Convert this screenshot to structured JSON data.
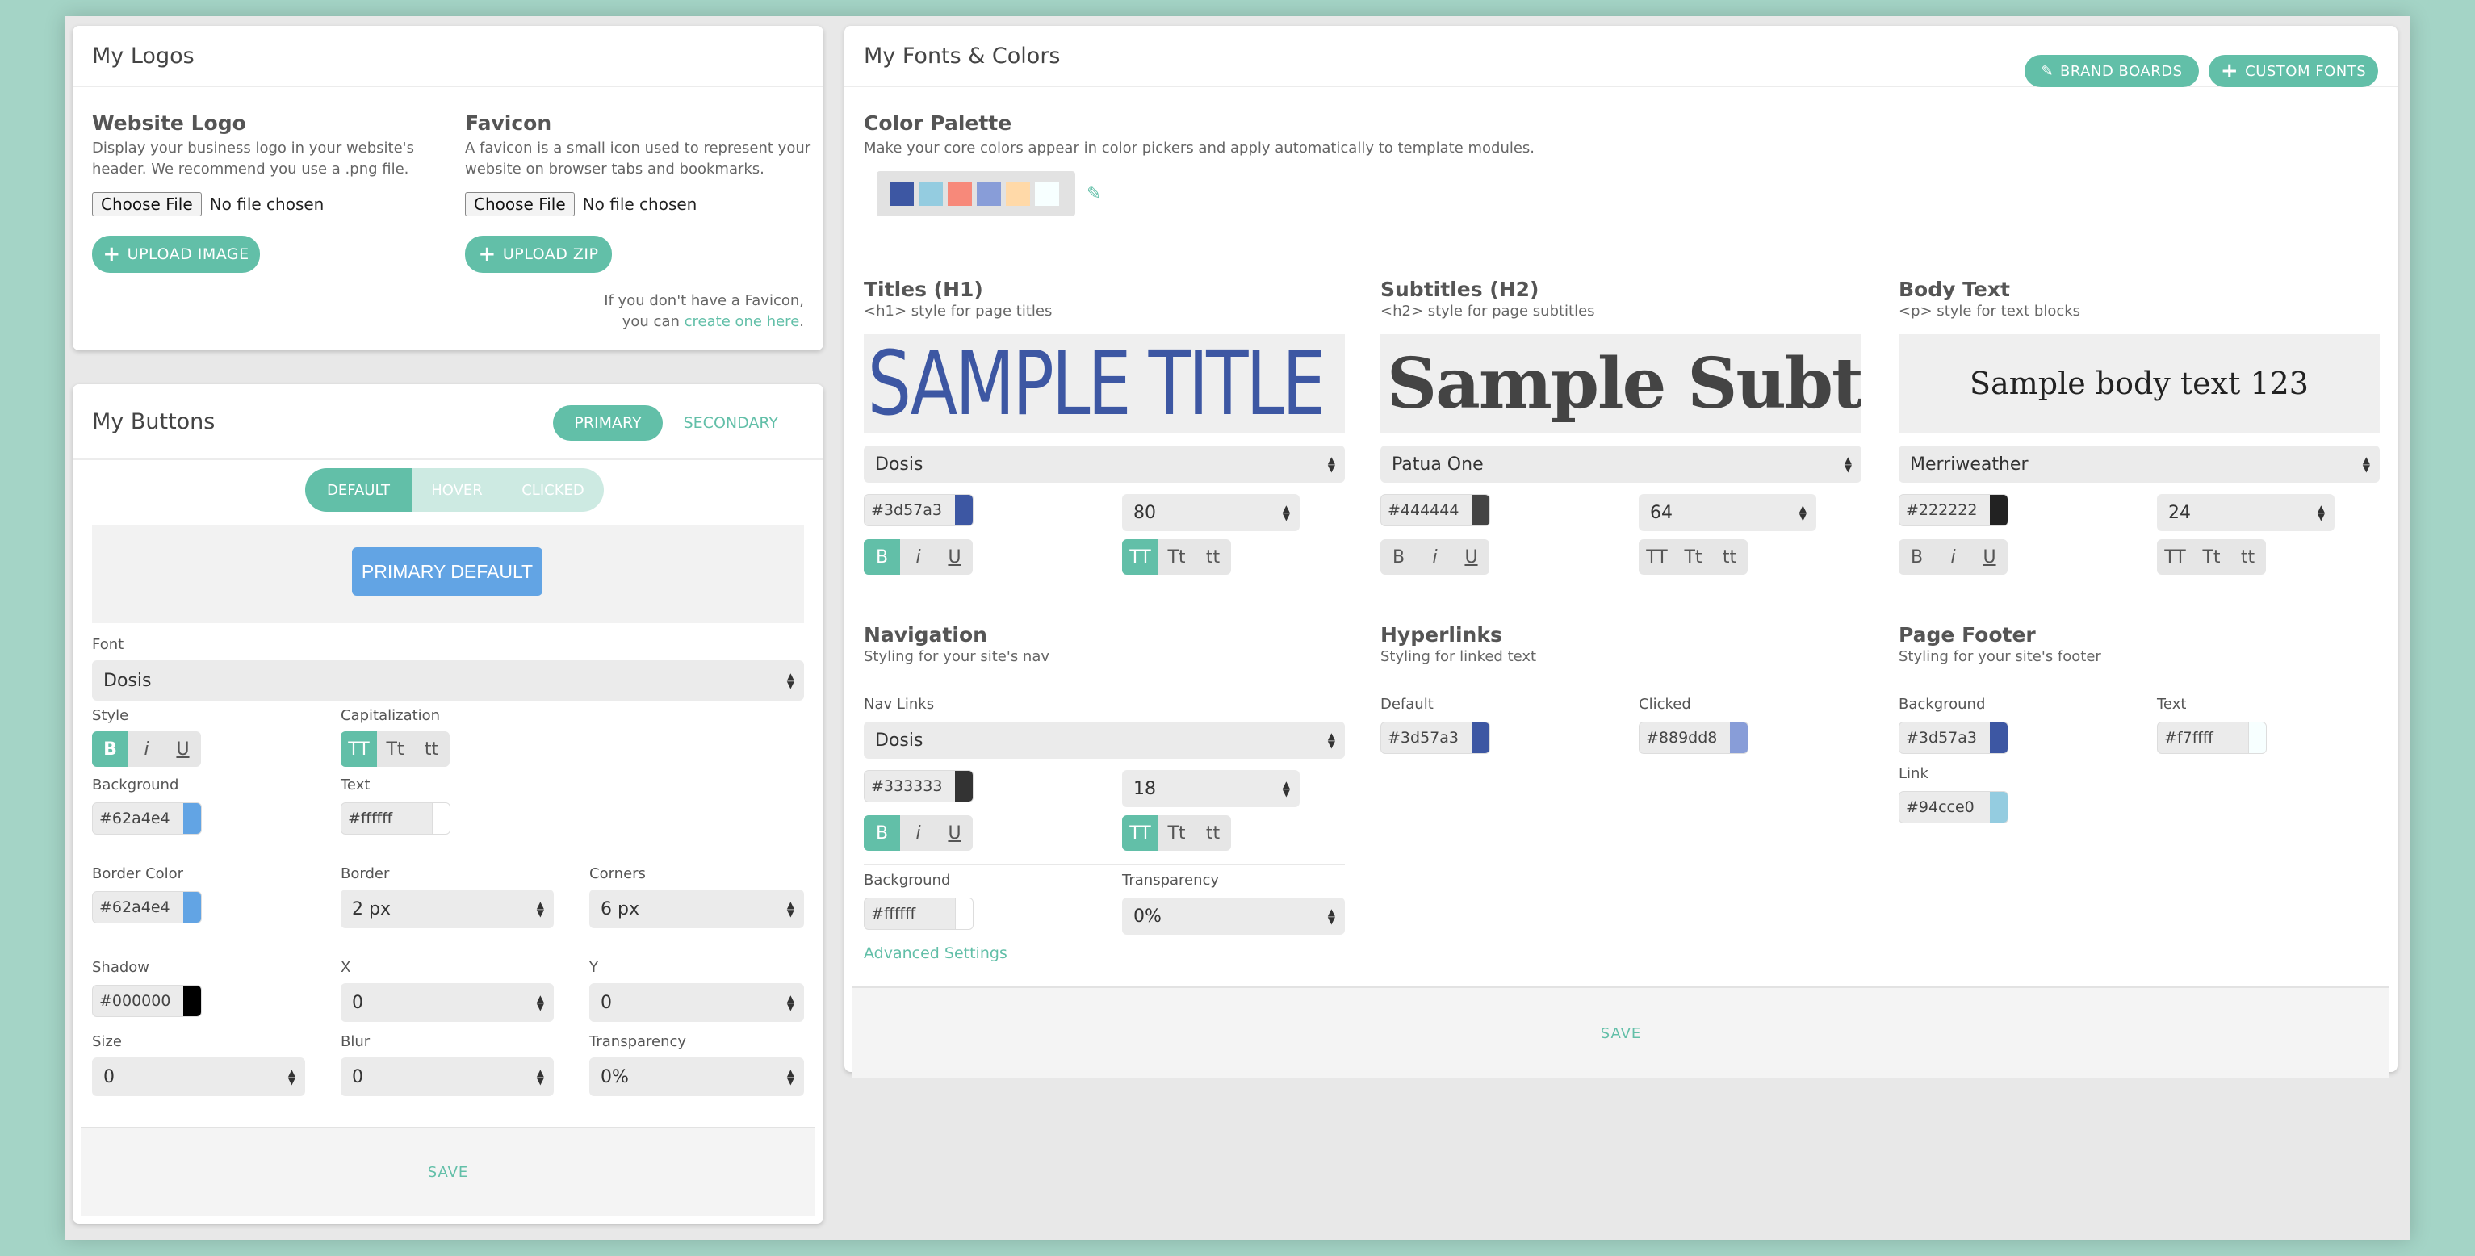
{
  "logos": {
    "title": "My Logos",
    "website_logo": {
      "heading": "Website Logo",
      "desc_line1": "Display your business logo in your website's",
      "desc_line2": "header. We recommend you use a .png file.",
      "choose_file": "Choose File",
      "no_file": "No file chosen",
      "upload": "UPLOAD IMAGE"
    },
    "favicon": {
      "heading": "Favicon",
      "desc_line1": "A favicon is a small icon used to represent your",
      "desc_line2": "website on browser tabs and bookmarks.",
      "choose_file": "Choose File",
      "no_file": "No file chosen",
      "upload": "UPLOAD ZIP",
      "note_line1": "If you don't have a Favicon,",
      "note_line2_prefix": "you can ",
      "note_link": "create one here",
      "note_suffix": "."
    }
  },
  "buttons": {
    "title": "My Buttons",
    "tabs": [
      "PRIMARY",
      "SECONDARY"
    ],
    "states": [
      "DEFAULT",
      "HOVER",
      "CLICKED"
    ],
    "preview_label": "PRIMARY DEFAULT",
    "font_label": "Font",
    "font_value": "Dosis",
    "style_label": "Style",
    "cap_label": "Capitalization",
    "style_buttons": [
      "B",
      "i",
      "U"
    ],
    "cap_buttons": [
      "TT",
      "Tt",
      "tt"
    ],
    "background_label": "Background",
    "background_value": "#62a4e4",
    "text_label": "Text",
    "text_value": "#ffffff",
    "border_color_label": "Border Color",
    "border_color_value": "#62a4e4",
    "border_label": "Border",
    "border_value": "2 px",
    "corners_label": "Corners",
    "corners_value": "6 px",
    "shadow_label": "Shadow",
    "shadow_value": "#000000",
    "x_label": "X",
    "x_value": "0",
    "y_label": "Y",
    "y_value": "0",
    "size_label": "Size",
    "size_value": "0",
    "blur_label": "Blur",
    "blur_value": "0",
    "transparency_label": "Transparency",
    "transparency_value": "0%",
    "save": "SAVE"
  },
  "fonts": {
    "title": "My Fonts & Colors",
    "brand_boards": "BRAND BOARDS",
    "custom_fonts": "CUSTOM FONTS",
    "palette_title": "Color Palette",
    "palette_desc": "Make your core colors appear in color pickers and apply automatically to template modules.",
    "palette_colors": [
      "#3d57a3",
      "#94cce0",
      "#f7897a",
      "#889dd8",
      "#ffd9a8",
      "#f7ffff"
    ],
    "titles": {
      "heading": "Titles (H1)",
      "desc": "<h1> style for page titles",
      "sample": "SAMPLE TITLE",
      "font": "Dosis",
      "color": "#3d57a3",
      "size": "80"
    },
    "subtitles": {
      "heading": "Subtitles (H2)",
      "desc": "<h2> style for page subtitles",
      "sample": "Sample Subtitle",
      "font": "Patua One",
      "color": "#444444",
      "size": "64"
    },
    "body": {
      "heading": "Body Text",
      "desc": "<p> style for text blocks",
      "sample": "Sample body text 123",
      "font": "Merriweather",
      "color": "#222222",
      "size": "24"
    },
    "style_buttons": [
      "B",
      "i",
      "U"
    ],
    "cap_buttons": [
      "TT",
      "Tt",
      "tt"
    ],
    "navigation": {
      "heading": "Navigation",
      "desc": "Styling for your site's nav",
      "nav_links_label": "Nav Links",
      "font": "Dosis",
      "color": "#333333",
      "size": "18",
      "background_label": "Background",
      "background_value": "#ffffff",
      "transparency_label": "Transparency",
      "transparency_value": "0%",
      "advanced": "Advanced Settings"
    },
    "hyperlinks": {
      "heading": "Hyperlinks",
      "desc": "Styling for linked text",
      "default_label": "Default",
      "default_value": "#3d57a3",
      "clicked_label": "Clicked",
      "clicked_value": "#889dd8"
    },
    "footer": {
      "heading": "Page Footer",
      "desc": "Styling for your site's footer",
      "background_label": "Background",
      "background_value": "#3d57a3",
      "text_label": "Text",
      "text_value": "#f7ffff",
      "link_label": "Link",
      "link_value": "#94cce0"
    },
    "save": "SAVE"
  }
}
